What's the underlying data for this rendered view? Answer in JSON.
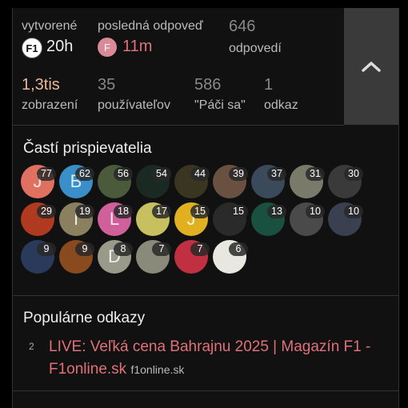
{
  "stats": {
    "created_label": "vytvorené",
    "created_value": "20h",
    "last_reply_label": "posledná odpoveď",
    "last_reply_value": "11m",
    "replies_value": "646",
    "replies_label": "odpovedí",
    "views_value": "1,3tis",
    "views_label": "zobrazení",
    "users_value": "35",
    "users_label": "používateľov",
    "likes_value": "586",
    "likes_label": "\"Páči sa\"",
    "links_value": "1",
    "links_label": "odkaz",
    "created_avatar_letter": "F1",
    "last_reply_avatar_letter": "F"
  },
  "toggle_icon": "chevron-up-icon",
  "contributors": {
    "title": "Častí prispievatelia",
    "rows": [
      [
        {
          "count": "77",
          "letter": "J",
          "color": "#e07060"
        },
        {
          "count": "62",
          "letter": "B",
          "color": "#3a8fc8"
        },
        {
          "count": "56",
          "letter": "",
          "color": "#4a5a3a"
        },
        {
          "count": "54",
          "letter": "",
          "color": "#1a2a22"
        },
        {
          "count": "44",
          "letter": "",
          "color": "#3a3520"
        },
        {
          "count": "39",
          "letter": "",
          "color": "#6a5040"
        },
        {
          "count": "37",
          "letter": "",
          "color": "#3a4a5a"
        },
        {
          "count": "31",
          "letter": "",
          "color": "#7a7a6a"
        },
        {
          "count": "30",
          "letter": "",
          "color": "#3a3a3a"
        }
      ],
      [
        {
          "count": "29",
          "letter": "",
          "color": "#b03a20"
        },
        {
          "count": "19",
          "letter": "I",
          "color": "#8a8060"
        },
        {
          "count": "18",
          "letter": "L",
          "color": "#d0609a"
        },
        {
          "count": "17",
          "letter": "",
          "color": "#c8c060"
        },
        {
          "count": "15",
          "letter": "J",
          "color": "#e0b020"
        },
        {
          "count": "15",
          "letter": "",
          "color": "#2a2a2a"
        },
        {
          "count": "13",
          "letter": "",
          "color": "#1a5040"
        },
        {
          "count": "10",
          "letter": "",
          "color": "#4a4a4a"
        },
        {
          "count": "10",
          "letter": "",
          "color": "#3a4050"
        }
      ],
      [
        {
          "count": "9",
          "letter": "",
          "color": "#2a3a5a"
        },
        {
          "count": "9",
          "letter": "",
          "color": "#8a4a20"
        },
        {
          "count": "8",
          "letter": "D",
          "color": "#9a9a8a"
        },
        {
          "count": "7",
          "letter": "",
          "color": "#8a8a7a"
        },
        {
          "count": "7",
          "letter": "",
          "color": "#c03040"
        },
        {
          "count": "6",
          "letter": "",
          "color": "#e8e8e0"
        }
      ]
    ]
  },
  "popular_links": {
    "title": "Populárne odkazy",
    "items": [
      {
        "count": "2",
        "text": "LIVE: Veľká cena Bahrajnu 2025 | Magazín F1 - F1online.sk",
        "domain": "f1online.sk"
      }
    ]
  },
  "colors": {
    "accent": "#e8b89a",
    "link": "#e0707a",
    "panel": "#111111"
  }
}
